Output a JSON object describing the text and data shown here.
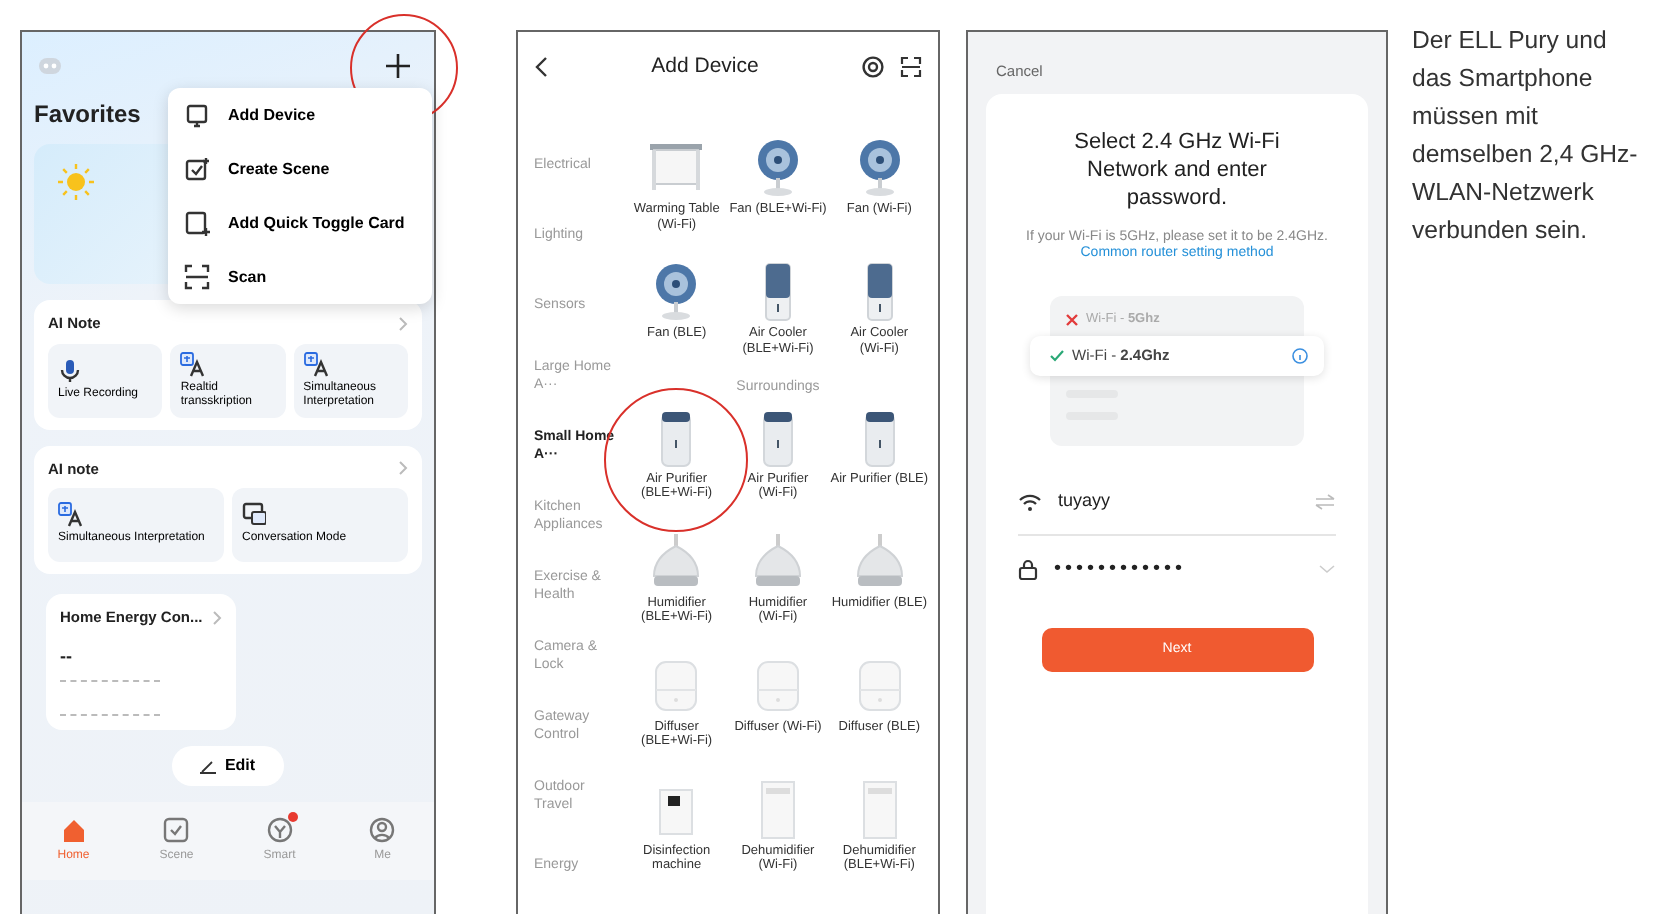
{
  "home": {
    "add_button": {
      "circled": true
    },
    "menu": [
      {
        "label": "Add Device",
        "kind": "device"
      },
      {
        "label": "Create Scene",
        "kind": "scene"
      },
      {
        "label": "Add Quick Toggle Card",
        "kind": "card"
      },
      {
        "label": "Scan",
        "kind": "scan"
      }
    ],
    "favorites_title": "Favorites",
    "ai_cards": [
      {
        "title": "AI Note",
        "items": [
          {
            "label": "Live Recording",
            "kind": "mic"
          },
          {
            "label": "Realtid transskription",
            "kind": "translate"
          },
          {
            "label": "Simultaneous Interpretation",
            "kind": "translate"
          }
        ]
      },
      {
        "title": "AI note",
        "items": [
          {
            "label": "Simultaneous Interpretation",
            "kind": "translate"
          },
          {
            "label": "Conversation Mode",
            "kind": "chat"
          }
        ]
      }
    ],
    "energy": {
      "title": "Home Energy Con...",
      "value": "--"
    },
    "edit_button": "Edit",
    "nav": [
      {
        "label": "Home",
        "kind": "home",
        "selected": true,
        "badge": false
      },
      {
        "label": "Scene",
        "kind": "scene",
        "selected": false,
        "badge": false
      },
      {
        "label": "Smart",
        "kind": "smart",
        "selected": false,
        "badge": true
      },
      {
        "label": "Me",
        "kind": "me",
        "selected": false,
        "badge": false
      }
    ]
  },
  "add_device": {
    "title": "Add Device",
    "categories": [
      {
        "label": "Electrical",
        "selected": false
      },
      {
        "label": "Lighting",
        "selected": false
      },
      {
        "label": "Sensors",
        "selected": false
      },
      {
        "label": "Large Home A···",
        "selected": false
      },
      {
        "label": "Small Home A···",
        "selected": true
      },
      {
        "label": "Kitchen Appliances",
        "selected": false
      },
      {
        "label": "Exercise & Health",
        "selected": false
      },
      {
        "label": "Camera & Lock",
        "selected": false
      },
      {
        "label": "Gateway Control",
        "selected": false
      },
      {
        "label": "Outdoor Travel",
        "selected": false
      },
      {
        "label": "Energy",
        "selected": false
      }
    ],
    "sections": [
      {
        "devices": [
          {
            "name": "Warming Table (Wi-Fi)",
            "kind": "table",
            "circled": false
          },
          {
            "name": "Fan (BLE+Wi-Fi)",
            "kind": "fan",
            "circled": false
          },
          {
            "name": "Fan (Wi-Fi)",
            "kind": "fan",
            "circled": false
          },
          {
            "name": "Fan (BLE)",
            "kind": "fan",
            "circled": false
          },
          {
            "name": "Air Cooler (BLE+Wi-Fi)",
            "kind": "cooler",
            "circled": false
          },
          {
            "name": "Air Cooler (Wi-Fi)",
            "kind": "cooler",
            "circled": false
          }
        ]
      },
      {
        "heading": "Surroundings",
        "devices": [
          {
            "name": "Air Purifier (BLE+Wi-Fi)",
            "kind": "purifier",
            "circled": true
          },
          {
            "name": "Air Purifier (Wi-Fi)",
            "kind": "purifier",
            "circled": false
          },
          {
            "name": "Air Purifier (BLE)",
            "kind": "purifier",
            "circled": false
          },
          {
            "name": "Humidifier (BLE+Wi-Fi)",
            "kind": "humidifier",
            "circled": false
          },
          {
            "name": "Humidifier (Wi-Fi)",
            "kind": "humidifier",
            "circled": false
          },
          {
            "name": "Humidifier (BLE)",
            "kind": "humidifier",
            "circled": false
          },
          {
            "name": "Diffuser (BLE+Wi-Fi)",
            "kind": "diffuser",
            "circled": false
          },
          {
            "name": "Diffuser (Wi-Fi)",
            "kind": "diffuser",
            "circled": false
          },
          {
            "name": "Diffuser (BLE)",
            "kind": "diffuser",
            "circled": false
          },
          {
            "name": "Disinfection machine",
            "kind": "disinfector",
            "circled": false
          },
          {
            "name": "Dehumidifier (Wi-Fi)",
            "kind": "dehumidifier",
            "circled": false
          },
          {
            "name": "Dehumidifier (BLE+Wi-Fi)",
            "kind": "dehumidifier",
            "circled": false
          }
        ]
      }
    ]
  },
  "wifi_setup": {
    "cancel": "Cancel",
    "heading": "Select 2.4 GHz Wi-Fi Network and enter password.",
    "hint": "If your Wi-Fi is 5GHz, please set it to be 2.4GHz.",
    "hint_link": "Common router setting method",
    "networks": [
      {
        "label": "Wi-Fi - **5Ghz**",
        "ok": false,
        "selected": false
      },
      {
        "label": "Wi-Fi - **2.4Ghz**",
        "ok": true,
        "selected": true
      }
    ],
    "ssid": "tuyayy",
    "password": "••••••••••••",
    "next_button": "Next"
  },
  "caption": "Der ELL Pury und das Smartphone müssen mit demselben 2,4 GHz-WLAN-Netzwerk verbunden sein."
}
